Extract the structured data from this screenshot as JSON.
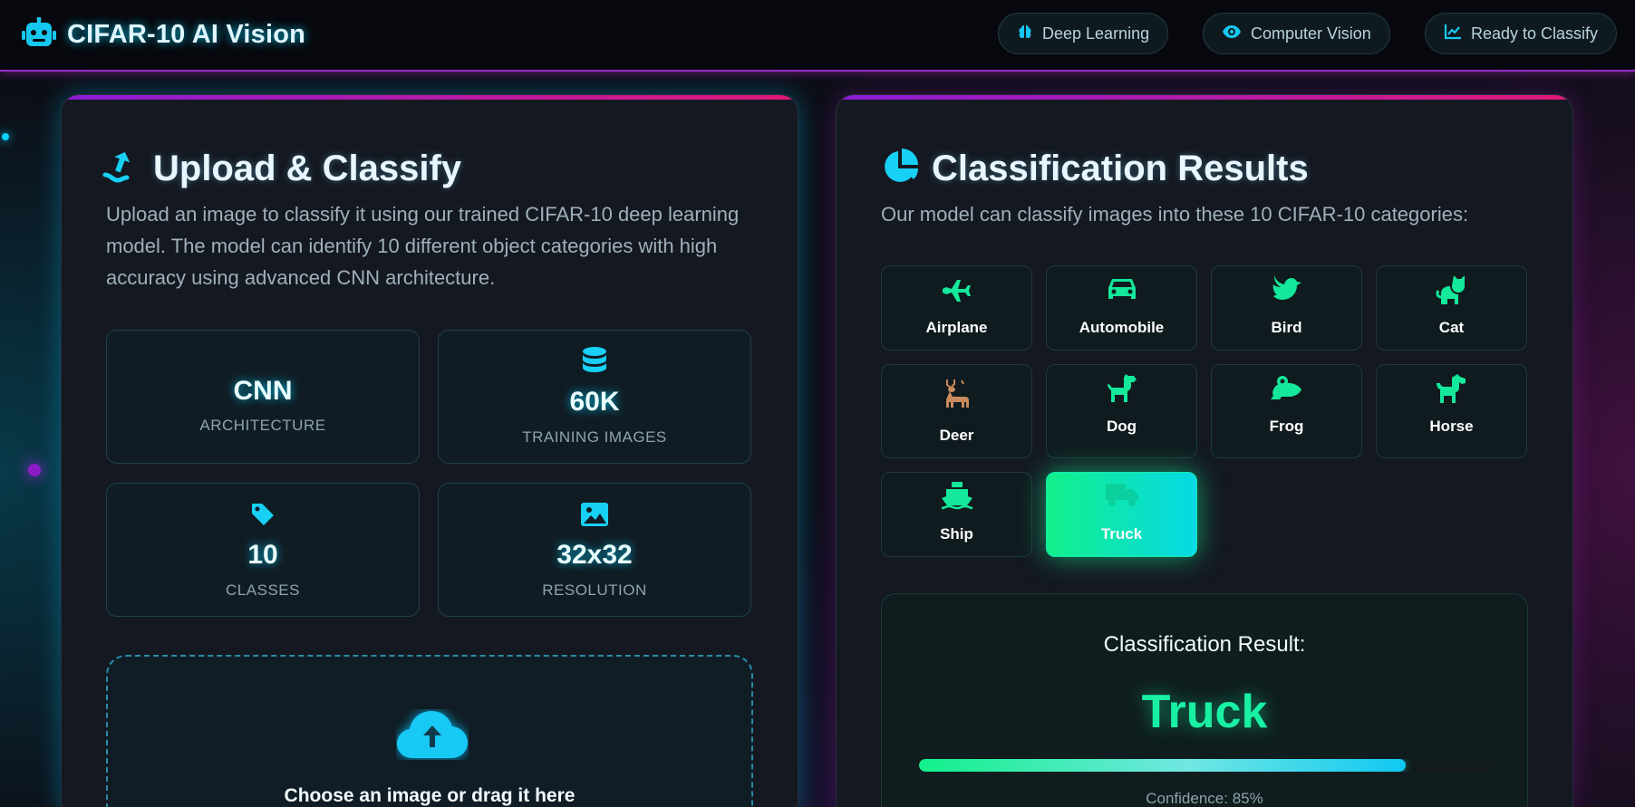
{
  "header": {
    "title": "CIFAR-10 AI Vision",
    "pills": [
      {
        "label": "Deep Learning",
        "icon": "brain-icon"
      },
      {
        "label": "Computer Vision",
        "icon": "eye-icon"
      },
      {
        "label": "Ready to Classify",
        "icon": "chart-line-icon"
      }
    ]
  },
  "upload_panel": {
    "title": "Upload & Classify",
    "description": "Upload an image to classify it using our trained CIFAR-10 deep learning model. The model can identify 10 different object categories with high accuracy using advanced CNN architecture.",
    "stats": [
      {
        "value": "CNN",
        "label": "ARCHITECTURE",
        "icon": ""
      },
      {
        "value": "60K",
        "label": "TRAINING IMAGES",
        "icon": "database-icon"
      },
      {
        "value": "10",
        "label": "CLASSES",
        "icon": "tag-icon"
      },
      {
        "value": "32x32",
        "label": "RESOLUTION",
        "icon": "image-icon"
      }
    ],
    "dropzone_text": "Choose an image or drag it here"
  },
  "results_panel": {
    "title": "Classification Results",
    "description": "Our model can classify images into these 10 CIFAR-10 categories:",
    "categories": [
      {
        "name": "Airplane",
        "icon": "plane-icon"
      },
      {
        "name": "Automobile",
        "icon": "car-icon"
      },
      {
        "name": "Bird",
        "icon": "dove-icon"
      },
      {
        "name": "Cat",
        "icon": "cat-icon"
      },
      {
        "name": "Deer",
        "icon": "deer-icon"
      },
      {
        "name": "Dog",
        "icon": "dog-icon"
      },
      {
        "name": "Frog",
        "icon": "frog-icon"
      },
      {
        "name": "Horse",
        "icon": "horse-icon"
      },
      {
        "name": "Ship",
        "icon": "ship-icon"
      },
      {
        "name": "Truck",
        "icon": "truck-icon"
      }
    ],
    "selected_category": "Truck",
    "result_heading": "Classification Result:",
    "result_value": "Truck",
    "confidence_text": "Confidence: 85%",
    "confidence": 0.85
  },
  "colors": {
    "accent_cyan": "#0ad3ff",
    "accent_green": "#12f08a",
    "accent_magenta": "#e0197a",
    "accent_purple": "#8c1bd9"
  }
}
